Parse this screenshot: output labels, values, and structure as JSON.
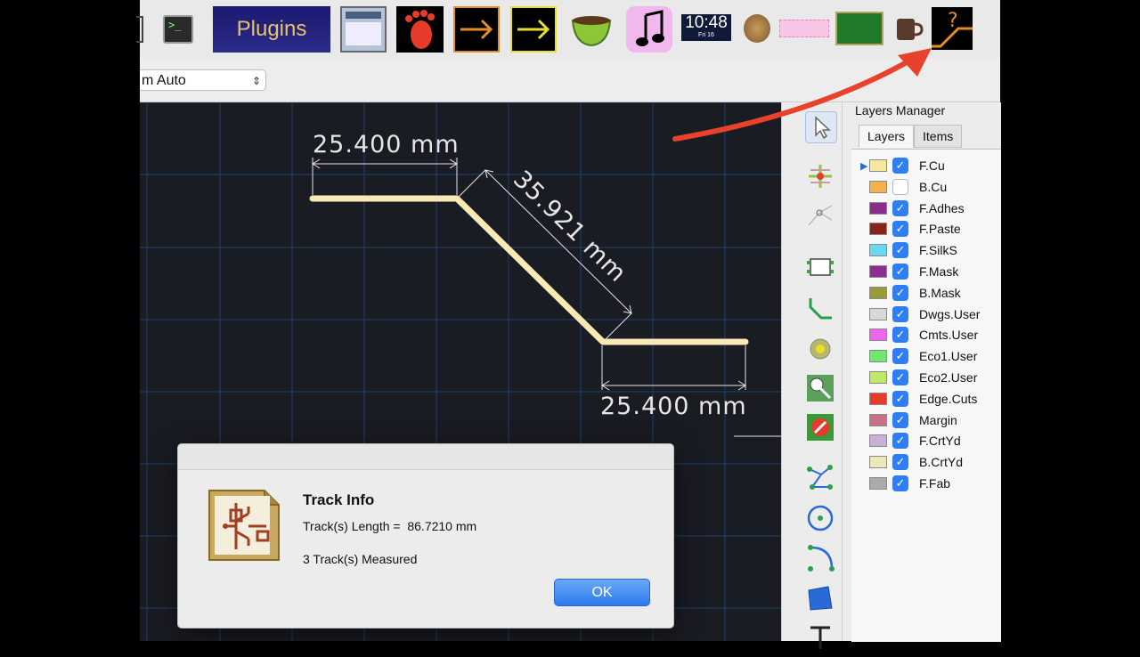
{
  "toolbar": {
    "plugins_label": "Plugins",
    "clock_time": "10:48",
    "clock_date": "Fri 16"
  },
  "options": {
    "zoom_value": "m Auto"
  },
  "canvas": {
    "dim_top": "25.400 mm",
    "dim_diag": "35.921 mm",
    "dim_bottom": "25.400 mm"
  },
  "layers_manager": {
    "title": "Layers Manager",
    "tabs": [
      "Layers",
      "Items"
    ],
    "layers": [
      {
        "name": "F.Cu",
        "color": "#f7e6a0",
        "checked": true,
        "active": true
      },
      {
        "name": "B.Cu",
        "color": "#f4b04c",
        "checked": false,
        "active": false
      },
      {
        "name": "F.Adhes",
        "color": "#8a2e8a",
        "checked": true,
        "active": false
      },
      {
        "name": "F.Paste",
        "color": "#8a2418",
        "checked": true,
        "active": false
      },
      {
        "name": "F.SilkS",
        "color": "#6ad8f0",
        "checked": true,
        "active": false
      },
      {
        "name": "F.Mask",
        "color": "#8c2e90",
        "checked": true,
        "active": false
      },
      {
        "name": "B.Mask",
        "color": "#9a9a3a",
        "checked": true,
        "active": false
      },
      {
        "name": "Dwgs.User",
        "color": "#d8d8d8",
        "checked": true,
        "active": false
      },
      {
        "name": "Cmts.User",
        "color": "#ee66ee",
        "checked": true,
        "active": false
      },
      {
        "name": "Eco1.User",
        "color": "#6ee86e",
        "checked": true,
        "active": false
      },
      {
        "name": "Eco2.User",
        "color": "#c2e86a",
        "checked": true,
        "active": false
      },
      {
        "name": "Edge.Cuts",
        "color": "#e83a2a",
        "checked": true,
        "active": false
      },
      {
        "name": "Margin",
        "color": "#c87288",
        "checked": true,
        "active": false
      },
      {
        "name": "F.CrtYd",
        "color": "#c8b0d8",
        "checked": true,
        "active": false
      },
      {
        "name": "B.CrtYd",
        "color": "#eee8b8",
        "checked": true,
        "active": false
      },
      {
        "name": "F.Fab",
        "color": "#aaaaaa",
        "checked": true,
        "active": false
      }
    ]
  },
  "dialog": {
    "title": "Track Info",
    "length_line": "Track(s) Length =  86.7210 mm",
    "count_line": "3 Track(s) Measured",
    "ok_label": "OK"
  },
  "colors": {
    "track": "#fbe9b5",
    "grid": "#1f3f6e",
    "dimension": "#e6e6e6",
    "annotation_arrow": "#e8412c"
  }
}
